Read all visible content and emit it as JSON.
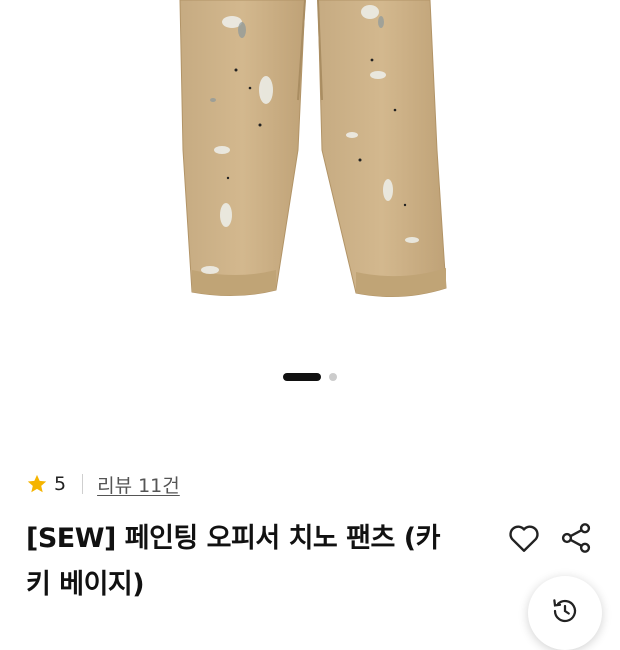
{
  "product": {
    "image_icon": "khaki-painted-chino-pants-image",
    "carousel": {
      "total": 2,
      "current": 1
    },
    "rating": {
      "icon": "star-icon",
      "value": "5",
      "color": "#f5b400"
    },
    "review_link": "리뷰 11건",
    "title_line1": "[SEW] 페인팅 오피서 치노 팬츠 (카",
    "title_line2": "키 베이지)"
  },
  "actions": {
    "like_icon": "heart-icon",
    "share_icon": "share-icon",
    "floating_icon": "history-icon"
  },
  "colors": {
    "text": "#111111",
    "dot_active": "#111111",
    "dot_inactive": "#cccccc"
  }
}
